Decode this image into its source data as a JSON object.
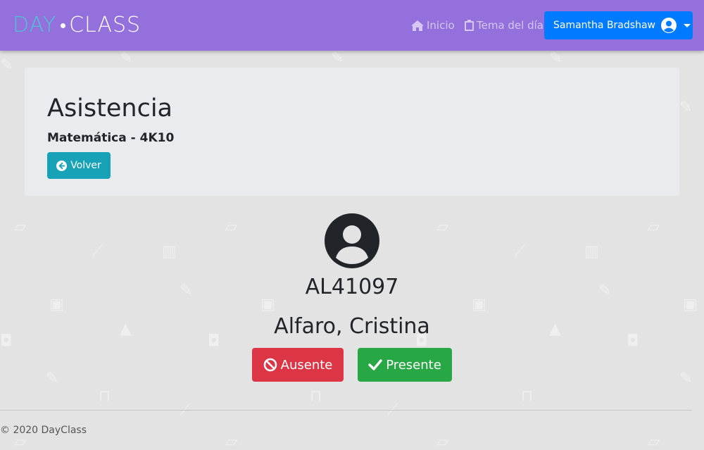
{
  "brand": {
    "day": "DAY",
    "class": "CLASS"
  },
  "nav": {
    "inicio_label": "Inicio",
    "tema_label": "Tema del día",
    "user_label": "Samantha Bradshaw"
  },
  "header": {
    "title": "Asistencia",
    "subtitle": "Matemática - 4K10",
    "back_label": "Volver"
  },
  "student": {
    "code": "AL41097",
    "name": "Alfaro, Cristina"
  },
  "actions": {
    "absent_label": "Ausente",
    "present_label": "Presente"
  },
  "footer": {
    "text": "© 2020 DayClass"
  },
  "colors": {
    "navbar": "#9370db",
    "primary": "#007bff",
    "info": "#17a2b8",
    "danger": "#dc3545",
    "success": "#28a745"
  }
}
